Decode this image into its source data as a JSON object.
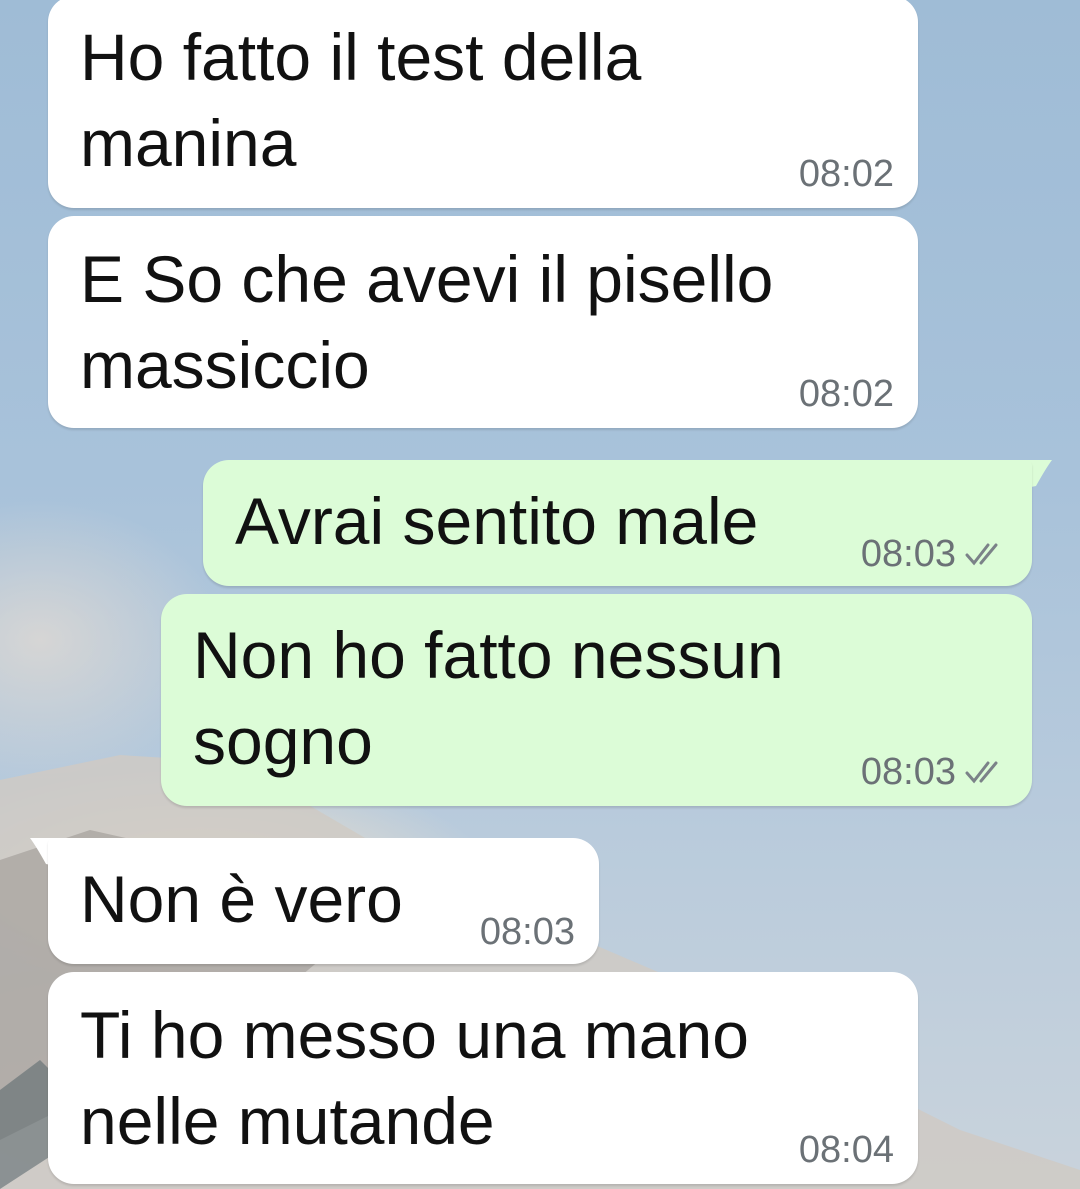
{
  "chat": {
    "messages": [
      {
        "direction": "incoming",
        "text": "Ho fatto il test della\nmanina",
        "time": "08:02"
      },
      {
        "direction": "incoming",
        "text": "E So che avevi il pisello\nmassiccio",
        "time": "08:02"
      },
      {
        "direction": "outgoing",
        "text": "Avrai sentito male",
        "time": "08:03",
        "status": "double-check-icon"
      },
      {
        "direction": "outgoing",
        "text": "Non ho fatto nessun\nsogno",
        "time": "08:03",
        "status": "double-check-icon"
      },
      {
        "direction": "incoming",
        "text": "Non è vero",
        "time": "08:03"
      },
      {
        "direction": "incoming",
        "text": "Ti ho messo una mano\nnelle mutande",
        "time": "08:04"
      }
    ]
  },
  "colors": {
    "incoming_bubble": "#ffffff",
    "outgoing_bubble": "#dcfcd7",
    "timestamp": "#6b7176"
  }
}
